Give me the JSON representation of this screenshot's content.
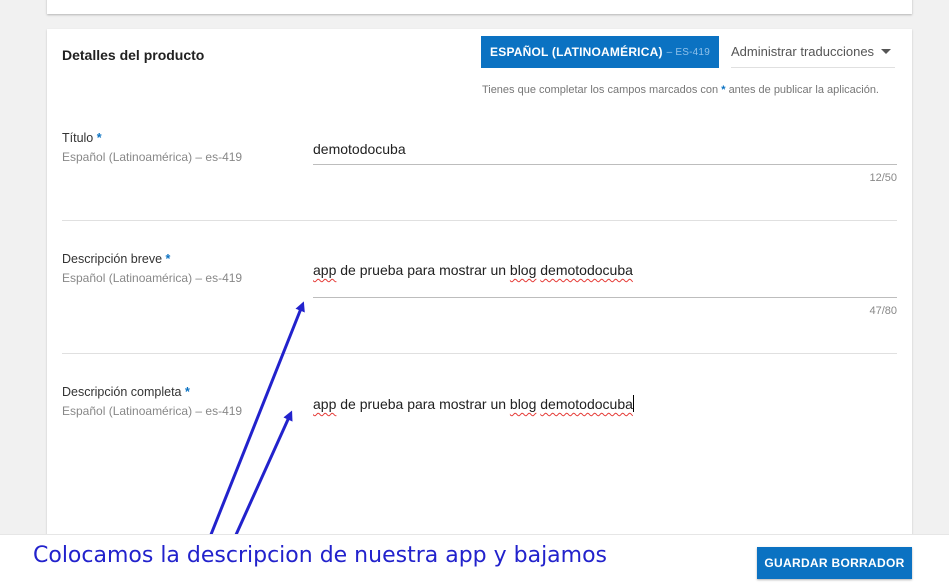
{
  "product_details": {
    "section_title": "Detalles del producto",
    "language_button": {
      "label": "ESPAÑOL (LATINOAMÉRICA)",
      "code": "– ES-419"
    },
    "manage_translations": "Administrar traducciones",
    "required_note_prefix": "Tienes que completar los campos marcados con",
    "required_note_star": "*",
    "required_note_suffix": "antes de publicar la aplicación.",
    "fields": [
      {
        "label": "Título",
        "required_star": "*",
        "locale": "Español (Latinoamérica) – es-419",
        "value": "demotodocuba",
        "counter": "12/50"
      },
      {
        "label": "Descripción breve",
        "required_star": "*",
        "locale": "Español (Latinoamérica) – es-419",
        "value_parts": [
          "app",
          " de prueba para mostrar un ",
          "blog",
          " ",
          "demotodocuba"
        ],
        "counter": "47/80"
      },
      {
        "label": "Descripción completa",
        "required_star": "*",
        "locale": "Español (Latinoamérica) – es-419",
        "value_parts": [
          "app",
          " de prueba para mostrar un ",
          "blog",
          " ",
          "demotodocuba"
        ]
      }
    ]
  },
  "footer": {
    "caption": "Colocamos la descripcion de nuestra app y bajamos",
    "save_draft": "GUARDAR BORRADOR"
  },
  "colors": {
    "accent": "#0b72c2",
    "annotation": "#2222cc",
    "spellcheck": "#e53935"
  }
}
